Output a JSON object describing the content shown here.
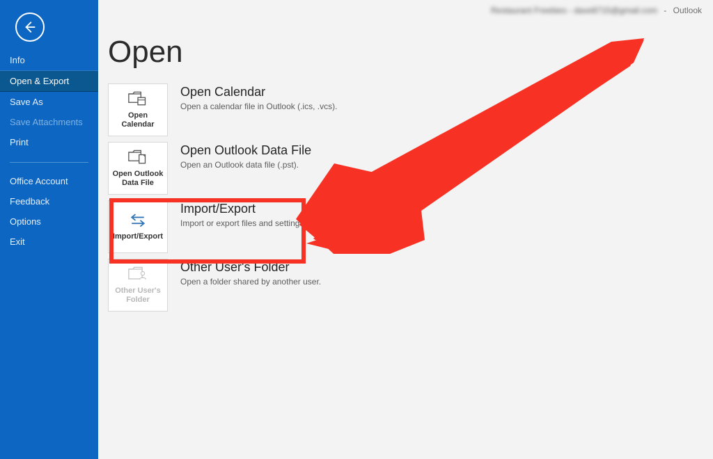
{
  "header": {
    "account_blurred": "Restaurant Freebies - dave8715@gmail.com",
    "app": "Outlook"
  },
  "sidebar": {
    "items": [
      {
        "label": "Info"
      },
      {
        "label": "Open & Export",
        "selected": true
      },
      {
        "label": "Save As"
      },
      {
        "label": "Save Attachments",
        "disabled": true
      },
      {
        "label": "Print"
      }
    ],
    "items2": [
      {
        "label": "Office Account"
      },
      {
        "label": "Feedback"
      },
      {
        "label": "Options"
      },
      {
        "label": "Exit"
      }
    ]
  },
  "page": {
    "title": "Open",
    "options": [
      {
        "tile": "Open Calendar",
        "title": "Open Calendar",
        "desc": "Open a calendar file in Outlook (.ics, .vcs)."
      },
      {
        "tile": "Open Outlook Data File",
        "title": "Open Outlook Data File",
        "desc": "Open an Outlook data file (.pst)."
      },
      {
        "tile": "Import/Export",
        "title": "Import/Export",
        "desc": "Import or export files and settings."
      },
      {
        "tile": "Other User's Folder",
        "title": "Other User's Folder",
        "desc": "Open a folder shared by another user.",
        "disabled": true
      }
    ]
  },
  "annotation": {
    "highlight_index": 2,
    "arrow_color": "#f73224"
  }
}
